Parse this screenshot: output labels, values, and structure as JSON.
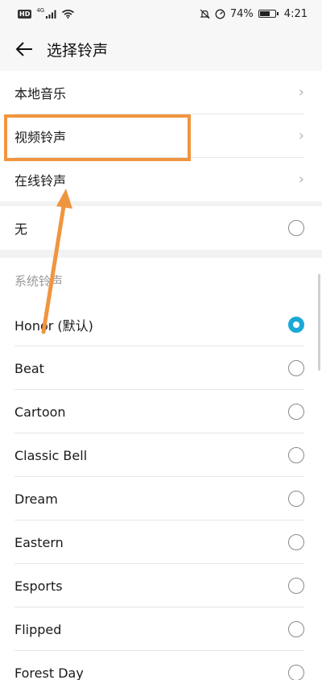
{
  "status_bar": {
    "hd": "HD",
    "network": "4G",
    "battery": "74%",
    "battery_fraction": 0.74,
    "time": "4:21"
  },
  "header": {
    "title": "选择铃声"
  },
  "sources": [
    {
      "label": "本地音乐"
    },
    {
      "label": "视频铃声"
    },
    {
      "label": "在线铃声"
    }
  ],
  "none_option": {
    "label": "无",
    "selected": false
  },
  "section_label": "系统铃声",
  "ringtones": [
    {
      "label": "Honor (默认)",
      "selected": true
    },
    {
      "label": "Beat",
      "selected": false
    },
    {
      "label": "Cartoon",
      "selected": false
    },
    {
      "label": "Classic Bell",
      "selected": false
    },
    {
      "label": "Dream",
      "selected": false
    },
    {
      "label": "Eastern",
      "selected": false
    },
    {
      "label": "Esports",
      "selected": false
    },
    {
      "label": "Flipped",
      "selected": false
    },
    {
      "label": "Forest Day",
      "selected": false
    }
  ],
  "colors": {
    "accent": "#1aa9d6",
    "annotation": "#f0953f"
  }
}
